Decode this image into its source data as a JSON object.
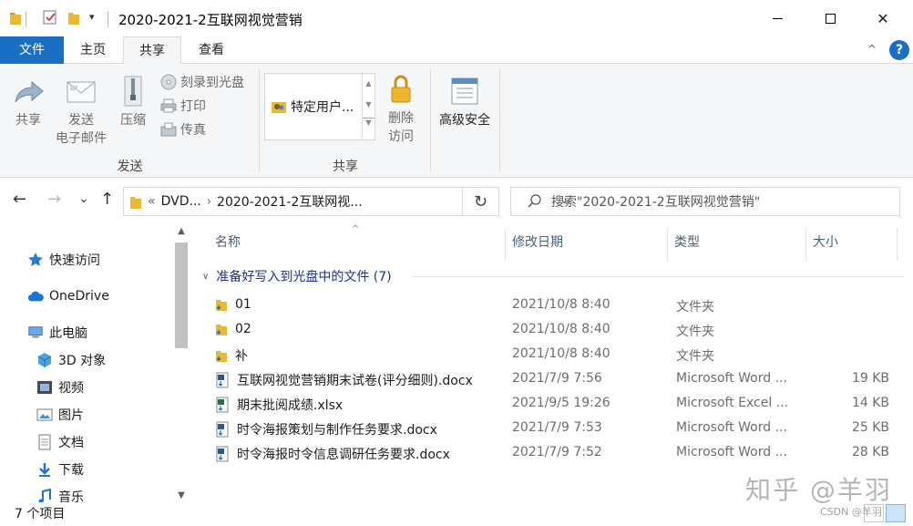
{
  "window": {
    "title": "2020-2021-2互联网视觉营销"
  },
  "quick_access": {
    "dropdown_glyph": "▾"
  },
  "window_controls": {
    "close_glyph": "✕"
  },
  "ribbon": {
    "tabs": {
      "file": "文件",
      "home": "主页",
      "share": "共享",
      "view": "查看"
    },
    "collapse_glyph": "^",
    "help_glyph": "?",
    "send_group": {
      "label": "发送",
      "share": "共享",
      "email_line1": "发送",
      "email_line2": "电子邮件",
      "zip": "压缩",
      "burn": "刻录到光盘",
      "print": "打印",
      "fax": "传真"
    },
    "share_group": {
      "label": "共享",
      "specific_people": "特定用户...",
      "remove_access_line1": "删除",
      "remove_access_line2": "访问",
      "advanced_security": "高级安全"
    }
  },
  "address_bar": {
    "back": "←",
    "forward": "→",
    "recent": "⌄",
    "up": "↑",
    "prefix": "«",
    "segment1": "DVD...",
    "sep": "›",
    "segment2": "2020-2021-2互联网视...",
    "dropdown": "⌄",
    "refresh": "↻"
  },
  "search": {
    "placeholder": "搜索\"2020-2021-2互联网视觉营销\""
  },
  "nav_pane": {
    "items": [
      {
        "label": "快速访问",
        "icon": "star-icon"
      },
      {
        "label": "OneDrive",
        "icon": "cloud-icon"
      },
      {
        "label": "此电脑",
        "icon": "computer-icon"
      },
      {
        "label": "3D 对象",
        "icon": "cube-icon"
      },
      {
        "label": "视频",
        "icon": "film-icon"
      },
      {
        "label": "图片",
        "icon": "picture-icon"
      },
      {
        "label": "文档",
        "icon": "document-icon"
      },
      {
        "label": "下载",
        "icon": "download-icon"
      },
      {
        "label": "音乐",
        "icon": "music-icon"
      }
    ]
  },
  "file_list": {
    "columns": {
      "name": "名称",
      "date": "修改日期",
      "type": "类型",
      "size": "大小"
    },
    "sort_glyph": "^",
    "group_header": "准备好写入到光盘中的文件 (7)",
    "rows": [
      {
        "name": "01",
        "date": "2021/10/8 8:40",
        "type": "文件夹",
        "size": "",
        "icon": "folder-icon"
      },
      {
        "name": "02",
        "date": "2021/10/8 8:40",
        "type": "文件夹",
        "size": "",
        "icon": "folder-icon"
      },
      {
        "name": "补",
        "date": "2021/10/8 8:40",
        "type": "文件夹",
        "size": "",
        "icon": "folder-icon"
      },
      {
        "name": "互联网视觉营销期末试卷(评分细则).docx",
        "date": "2021/7/9 7:56",
        "type": "Microsoft Word ...",
        "size": "19 KB",
        "icon": "word-icon"
      },
      {
        "name": "期末批阅成绩.xlsx",
        "date": "2021/9/5 19:26",
        "type": "Microsoft Excel ...",
        "size": "14 KB",
        "icon": "excel-icon"
      },
      {
        "name": "时令海报策划与制作任务要求.docx",
        "date": "2021/7/9 7:53",
        "type": "Microsoft Word ...",
        "size": "25 KB",
        "icon": "word-icon"
      },
      {
        "name": "时令海报时令信息调研任务要求.docx",
        "date": "2021/7/9 7:52",
        "type": "Microsoft Word ...",
        "size": "28 KB",
        "icon": "word-icon"
      }
    ]
  },
  "status_bar": {
    "item_count": "7 个项目"
  },
  "watermark": {
    "main": "知乎 @羊羽",
    "sub": "CSDN @羊羽"
  },
  "colors": {
    "accent": "#1a6fc4",
    "folder": "#e8b936",
    "group_header": "#1e3287"
  }
}
